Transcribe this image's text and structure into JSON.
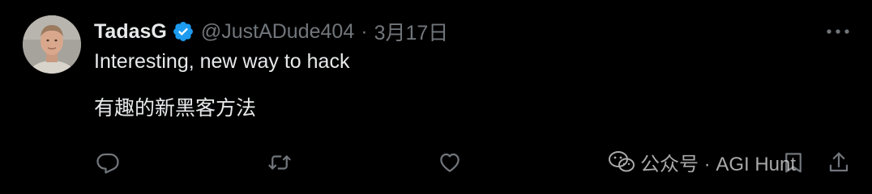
{
  "author": {
    "display_name": "TadasG",
    "handle": "@JustADude404",
    "separator": "·",
    "timestamp": "3月17日",
    "verified": true
  },
  "tweet": {
    "line1": "Interesting, new way to hack",
    "line2": "有趣的新黑客方法"
  },
  "actions": {
    "reply_icon": "reply-icon",
    "retweet_icon": "retweet-icon",
    "like_icon": "heart-icon",
    "bookmark_icon": "bookmark-icon",
    "share_icon": "share-icon"
  },
  "watermark": {
    "text": "公众号 · AGI Hunt"
  },
  "colors": {
    "background": "#000000",
    "text_primary": "#e7e9ea",
    "text_secondary": "#71767b",
    "verified_blue": "#1d9bf0"
  }
}
